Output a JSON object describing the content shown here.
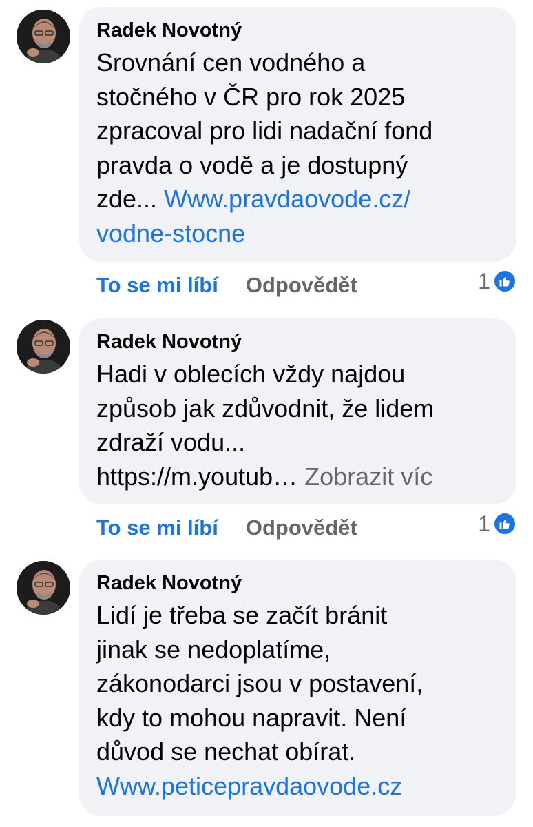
{
  "comments": [
    {
      "author": "Radek Novotný",
      "lines": [
        "Srovnání cen vodného a",
        "stočného v ČR pro rok 2025",
        "zpracoval pro lidi nadační fond",
        "pravda o vodě a je dostupný"
      ],
      "last_prefix": "zde... ",
      "link_part1": "Www.pravdaovode.cz/",
      "link_part2": "vodne-stocne",
      "like_label": "To se mi líbí",
      "reply_label": "Odpovědět",
      "reaction_count": "1"
    },
    {
      "author": "Radek Novotný",
      "lines": [
        "Hadi v oblecích vždy najdou",
        "způsob jak zdůvodnit, že lidem",
        "zdraží vodu..."
      ],
      "truncated_text": "https://m.youtub…",
      "see_more": "Zobrazit víc",
      "like_label": "To se mi líbí",
      "reply_label": "Odpovědět",
      "reaction_count": "1"
    },
    {
      "author": "Radek Novotný",
      "lines": [
        "Lidí je třeba se začít bránit",
        "jinak se nedoplatíme,",
        "zákonodarci jsou v postavení,",
        "kdy to mohou napravit. Není",
        "důvod se nechat obírat."
      ],
      "link": "Www.peticepravdaovode.cz"
    }
  ],
  "colors": {
    "link": "#1b74e4",
    "bubble": "#f0f2f5",
    "secondary_text": "#65676b"
  },
  "icons": [
    "avatar",
    "like-icon"
  ]
}
